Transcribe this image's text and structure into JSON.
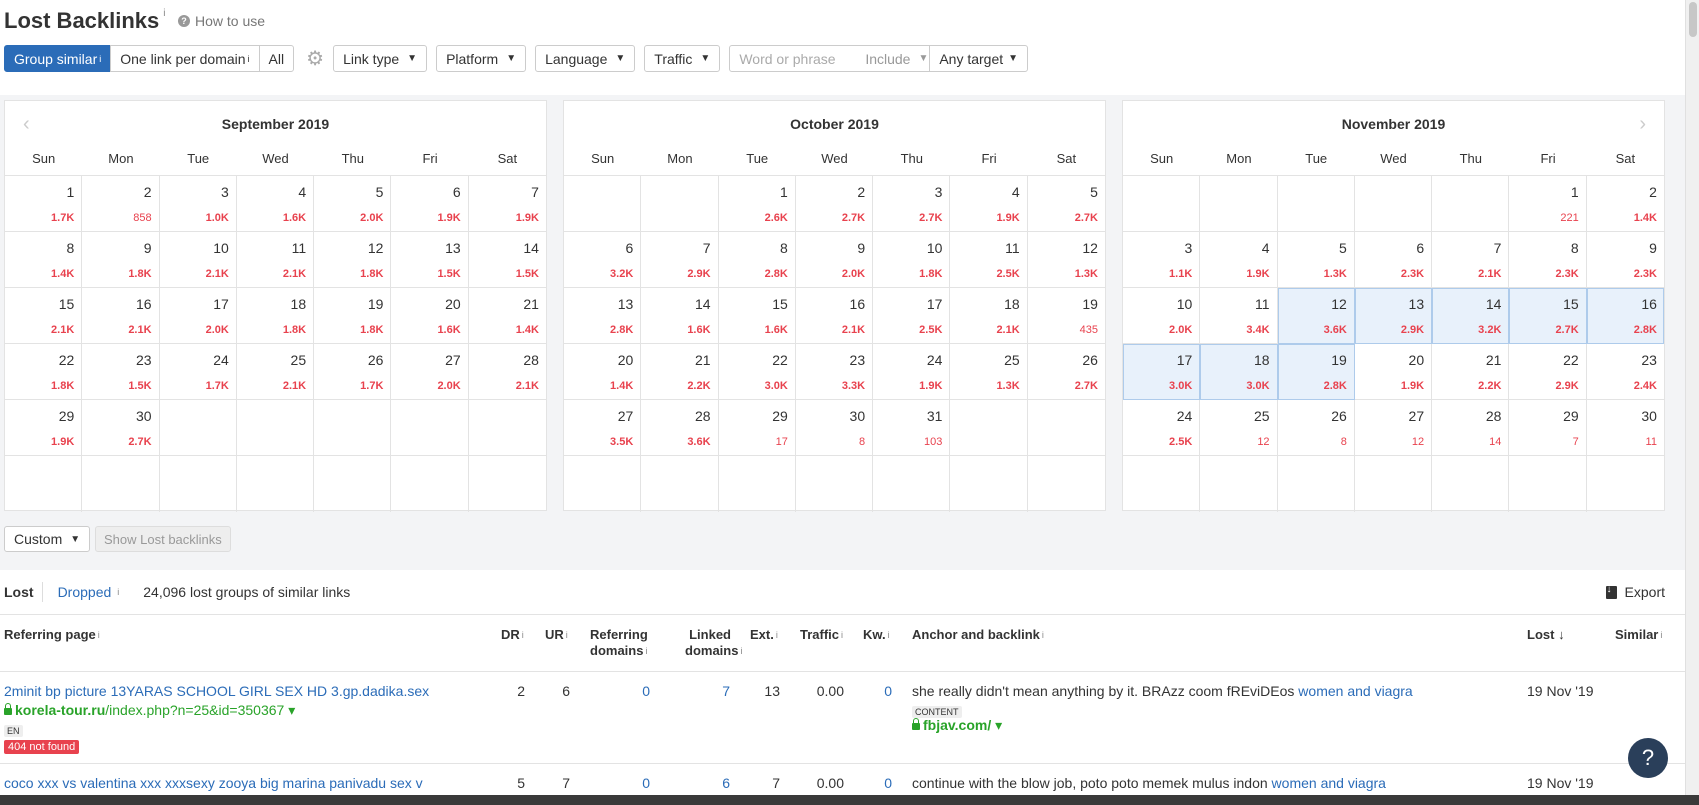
{
  "header": {
    "title": "Lost Backlinks",
    "title_info": "i",
    "how_to_use": "How to use"
  },
  "toolbar": {
    "group_similar": "Group similar",
    "one_link_per_domain": "One link per domain",
    "all": "All",
    "info": "i",
    "link_type": "Link type",
    "platform": "Platform",
    "language": "Language",
    "traffic": "Traffic",
    "word_placeholder": "Word or phrase",
    "include": "Include",
    "any_target": "Any target"
  },
  "weekdays": [
    "Sun",
    "Mon",
    "Tue",
    "Wed",
    "Thu",
    "Fri",
    "Sat"
  ],
  "calendars": [
    {
      "month": "September 2019",
      "weeks": [
        [
          [
            "1",
            "1.7K"
          ],
          [
            "2",
            "858"
          ],
          [
            "3",
            "1.0K"
          ],
          [
            "4",
            "1.6K"
          ],
          [
            "5",
            "2.0K"
          ],
          [
            "6",
            "1.9K"
          ],
          [
            "7",
            "1.9K"
          ]
        ],
        [
          [
            "8",
            "1.4K"
          ],
          [
            "9",
            "1.8K"
          ],
          [
            "10",
            "2.1K"
          ],
          [
            "11",
            "2.1K"
          ],
          [
            "12",
            "1.8K"
          ],
          [
            "13",
            "1.5K"
          ],
          [
            "14",
            "1.5K"
          ]
        ],
        [
          [
            "15",
            "2.1K"
          ],
          [
            "16",
            "2.1K"
          ],
          [
            "17",
            "2.0K"
          ],
          [
            "18",
            "1.8K"
          ],
          [
            "19",
            "1.8K"
          ],
          [
            "20",
            "1.6K"
          ],
          [
            "21",
            "1.4K"
          ]
        ],
        [
          [
            "22",
            "1.8K"
          ],
          [
            "23",
            "1.5K"
          ],
          [
            "24",
            "1.7K"
          ],
          [
            "25",
            "2.1K"
          ],
          [
            "26",
            "1.7K"
          ],
          [
            "27",
            "2.0K"
          ],
          [
            "28",
            "2.1K"
          ]
        ],
        [
          [
            "29",
            "1.9K"
          ],
          [
            "30",
            "2.7K"
          ],
          [
            "",
            ""
          ],
          [
            "",
            ""
          ],
          [
            "",
            ""
          ],
          [
            "",
            ""
          ],
          [
            "",
            ""
          ]
        ],
        [
          [
            "",
            ""
          ],
          [
            "",
            ""
          ],
          [
            "",
            ""
          ],
          [
            "",
            ""
          ],
          [
            "",
            ""
          ],
          [
            "",
            ""
          ],
          [
            "",
            ""
          ]
        ]
      ]
    },
    {
      "month": "October 2019",
      "weeks": [
        [
          [
            "",
            ""
          ],
          [
            "",
            ""
          ],
          [
            "1",
            "2.6K"
          ],
          [
            "2",
            "2.7K"
          ],
          [
            "3",
            "2.7K"
          ],
          [
            "4",
            "1.9K"
          ],
          [
            "5",
            "2.7K"
          ]
        ],
        [
          [
            "6",
            "3.2K"
          ],
          [
            "7",
            "2.9K"
          ],
          [
            "8",
            "2.8K"
          ],
          [
            "9",
            "2.0K"
          ],
          [
            "10",
            "1.8K"
          ],
          [
            "11",
            "2.5K"
          ],
          [
            "12",
            "1.3K"
          ]
        ],
        [
          [
            "13",
            "2.8K"
          ],
          [
            "14",
            "1.6K"
          ],
          [
            "15",
            "1.6K"
          ],
          [
            "16",
            "2.1K"
          ],
          [
            "17",
            "2.5K"
          ],
          [
            "18",
            "2.1K"
          ],
          [
            "19",
            "435"
          ]
        ],
        [
          [
            "20",
            "1.4K"
          ],
          [
            "21",
            "2.2K"
          ],
          [
            "22",
            "3.0K"
          ],
          [
            "23",
            "3.3K"
          ],
          [
            "24",
            "1.9K"
          ],
          [
            "25",
            "1.3K"
          ],
          [
            "26",
            "2.7K"
          ]
        ],
        [
          [
            "27",
            "3.5K"
          ],
          [
            "28",
            "3.6K"
          ],
          [
            "29",
            "17"
          ],
          [
            "30",
            "8"
          ],
          [
            "31",
            "103"
          ],
          [
            "",
            ""
          ],
          [
            "",
            ""
          ]
        ],
        [
          [
            "",
            ""
          ],
          [
            "",
            ""
          ],
          [
            "",
            ""
          ],
          [
            "",
            ""
          ],
          [
            "",
            ""
          ],
          [
            "",
            ""
          ],
          [
            "",
            ""
          ]
        ]
      ]
    },
    {
      "month": "November 2019",
      "weeks": [
        [
          [
            "",
            ""
          ],
          [
            "",
            ""
          ],
          [
            "",
            ""
          ],
          [
            "",
            ""
          ],
          [
            "",
            ""
          ],
          [
            "1",
            "221"
          ],
          [
            "2",
            "1.4K"
          ]
        ],
        [
          [
            "3",
            "1.1K"
          ],
          [
            "4",
            "1.9K"
          ],
          [
            "5",
            "1.3K"
          ],
          [
            "6",
            "2.3K"
          ],
          [
            "7",
            "2.1K"
          ],
          [
            "8",
            "2.3K"
          ],
          [
            "9",
            "2.3K"
          ]
        ],
        [
          [
            "10",
            "2.0K"
          ],
          [
            "11",
            "3.4K"
          ],
          [
            "12",
            "3.6K"
          ],
          [
            "13",
            "2.9K"
          ],
          [
            "14",
            "3.2K"
          ],
          [
            "15",
            "2.7K"
          ],
          [
            "16",
            "2.8K"
          ]
        ],
        [
          [
            "17",
            "3.0K"
          ],
          [
            "18",
            "3.0K"
          ],
          [
            "19",
            "2.8K"
          ],
          [
            "20",
            "1.9K"
          ],
          [
            "21",
            "2.2K"
          ],
          [
            "22",
            "2.9K"
          ],
          [
            "23",
            "2.4K"
          ]
        ],
        [
          [
            "24",
            "2.5K"
          ],
          [
            "25",
            "12"
          ],
          [
            "26",
            "8"
          ],
          [
            "27",
            "12"
          ],
          [
            "28",
            "14"
          ],
          [
            "29",
            "7"
          ],
          [
            "30",
            "11"
          ]
        ],
        [
          [
            "",
            ""
          ],
          [
            "",
            ""
          ],
          [
            "",
            ""
          ],
          [
            "",
            ""
          ],
          [
            "",
            ""
          ],
          [
            "",
            ""
          ],
          [
            "",
            ""
          ]
        ]
      ],
      "selected_days": [
        "12",
        "13",
        "14",
        "15",
        "16",
        "17",
        "18",
        "19"
      ]
    }
  ],
  "range_controls": {
    "custom": "Custom",
    "show_lost": "Show Lost backlinks"
  },
  "tabs": {
    "lost": "Lost",
    "dropped": "Dropped",
    "info": "i",
    "count": "24,096 lost groups of similar links",
    "export": "Export"
  },
  "columns": {
    "referring_page": "Referring page",
    "dr": "DR",
    "ur": "UR",
    "referring_domains_1": "Referring",
    "referring_domains_2": "domains",
    "linked_domains_1": "Linked",
    "linked_domains_2": "domains",
    "ext": "Ext.",
    "traffic": "Traffic",
    "kw": "Kw.",
    "anchor": "Anchor and backlink",
    "lost": "Lost",
    "similar": "Similar",
    "info": "i"
  },
  "rows": [
    {
      "title": "2minit bp picture 13YARAS SCHOOL GIRL SEX HD 3.gp.dadika.sex",
      "domain": "korela-tour.ru",
      "path": "/index.php?n=25&id=350367",
      "lang": "EN",
      "status": "404 not found",
      "dr": "2",
      "ur": "6",
      "ref_domains": "0",
      "linked_domains": "7",
      "ext": "13",
      "traffic": "0.00",
      "kw": "0",
      "anchor_text": "she really didn't mean anything by it. BRAzz coom fREviDEos",
      "anchor_link": "women and viagra",
      "anchor_tag": "CONTENT",
      "target": "fbjav.com/",
      "lost": "19 Nov '19"
    },
    {
      "title": "coco xxx vs valentina xxx xxxsexy zooya big marina panivadu sex v",
      "dr": "5",
      "ur": "7",
      "ref_domains": "0",
      "linked_domains": "6",
      "ext": "7",
      "traffic": "0.00",
      "kw": "0",
      "anchor_text": "continue with the blow job, poto poto memek mulus indon",
      "anchor_link": "women and viagra",
      "lost": "19 Nov '19"
    }
  ],
  "help": "?"
}
